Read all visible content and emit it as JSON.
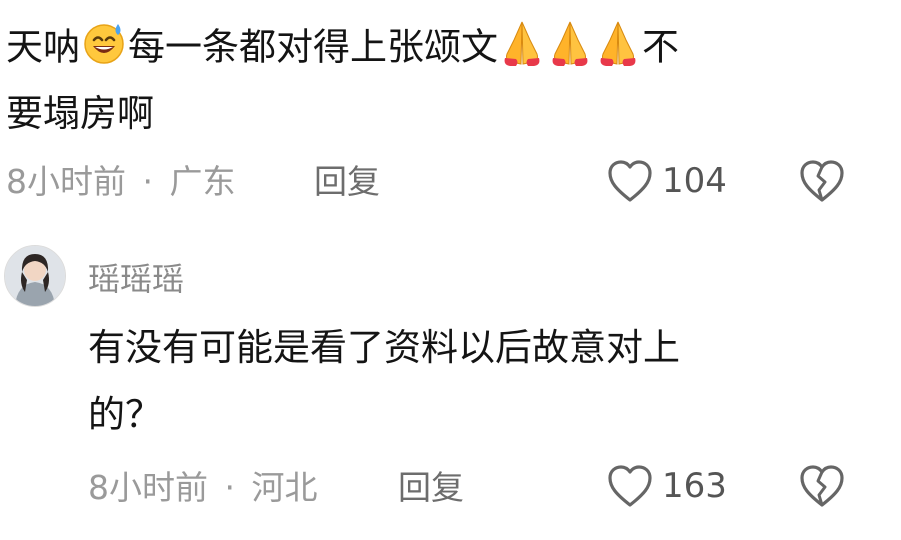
{
  "comment1": {
    "text_part1": "天呐",
    "text_part2": "每一条都对得上张颂文",
    "text_part3": "不",
    "text_line2": "要塌房啊",
    "emoji_sweat": "sweat-smile-emoji",
    "emoji_pray": "folded-hands-emoji",
    "time": "8小时前",
    "separator": "·",
    "location": "广东",
    "reply_label": "回复",
    "like_count": "104"
  },
  "comment2": {
    "username": "瑶瑶瑶",
    "text_line1": "有没有可能是看了资料以后故意对上",
    "text_line2": "的？",
    "time": "8小时前",
    "separator": "·",
    "location": "河北",
    "reply_label": "回复",
    "like_count": "163"
  },
  "icons": {
    "like": "heart-outline-icon",
    "dislike": "broken-heart-icon"
  },
  "colors": {
    "primary_text": "#141414",
    "meta_text": "#9a9a9a",
    "icon": "#666666"
  }
}
